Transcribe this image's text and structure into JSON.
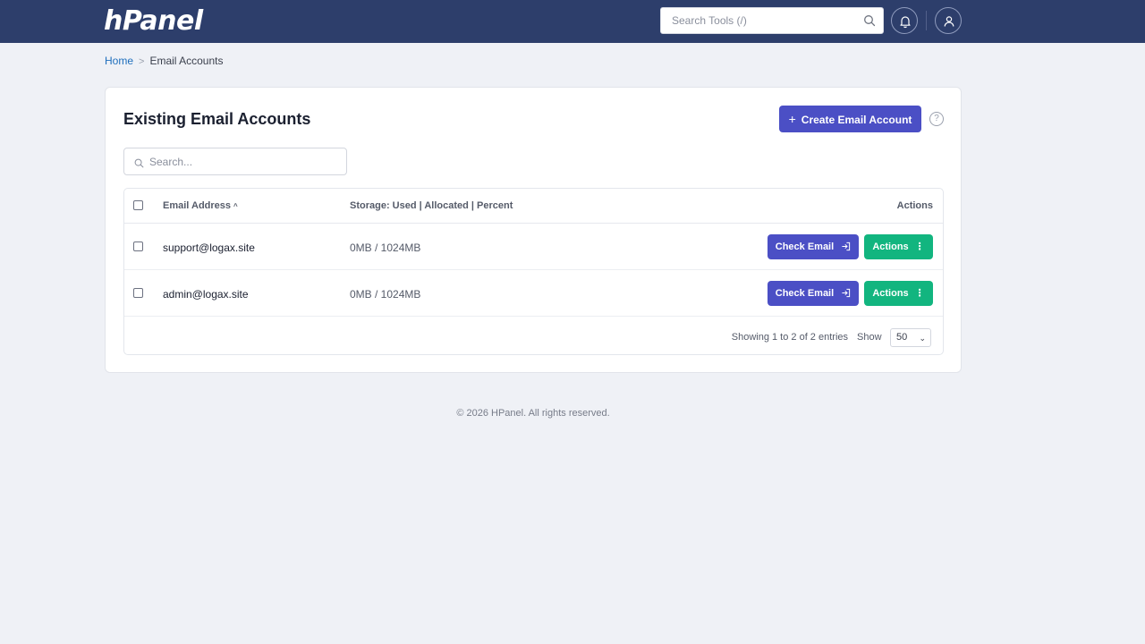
{
  "header": {
    "logo": "hPanel",
    "search_placeholder": "Search Tools (/)",
    "icons": {
      "search": "search-icon",
      "bell": "bell-icon",
      "user": "user-icon"
    }
  },
  "breadcrumb": {
    "home": "Home",
    "separator": ">",
    "current": "Email Accounts"
  },
  "card": {
    "title": "Existing Email Accounts",
    "create_label": "Create Email Account",
    "help": "?",
    "search_placeholder": "Search..."
  },
  "table": {
    "columns": {
      "email": "Email Address",
      "sort": "^",
      "storage": "Storage: Used | Allocated | Percent",
      "actions": "Actions"
    },
    "rows": [
      {
        "email": "support@logax.site",
        "storage": "0MB / 1024MB",
        "check": "Check Email",
        "actions": "Actions"
      },
      {
        "email": "admin@logax.site",
        "storage": "0MB / 1024MB",
        "check": "Check Email",
        "actions": "Actions"
      }
    ],
    "footer": {
      "showing": "Showing 1 to 2 of 2 entries",
      "show_label": "Show",
      "page_size": "50"
    }
  },
  "footer": {
    "copyright": "© 2026 HPanel. All rights reserved."
  },
  "colors": {
    "topbar": "#2d3e6b",
    "primary": "#4b4fc5",
    "success": "#12b57f",
    "link": "#1f6fbd",
    "background": "#eff1f6"
  }
}
